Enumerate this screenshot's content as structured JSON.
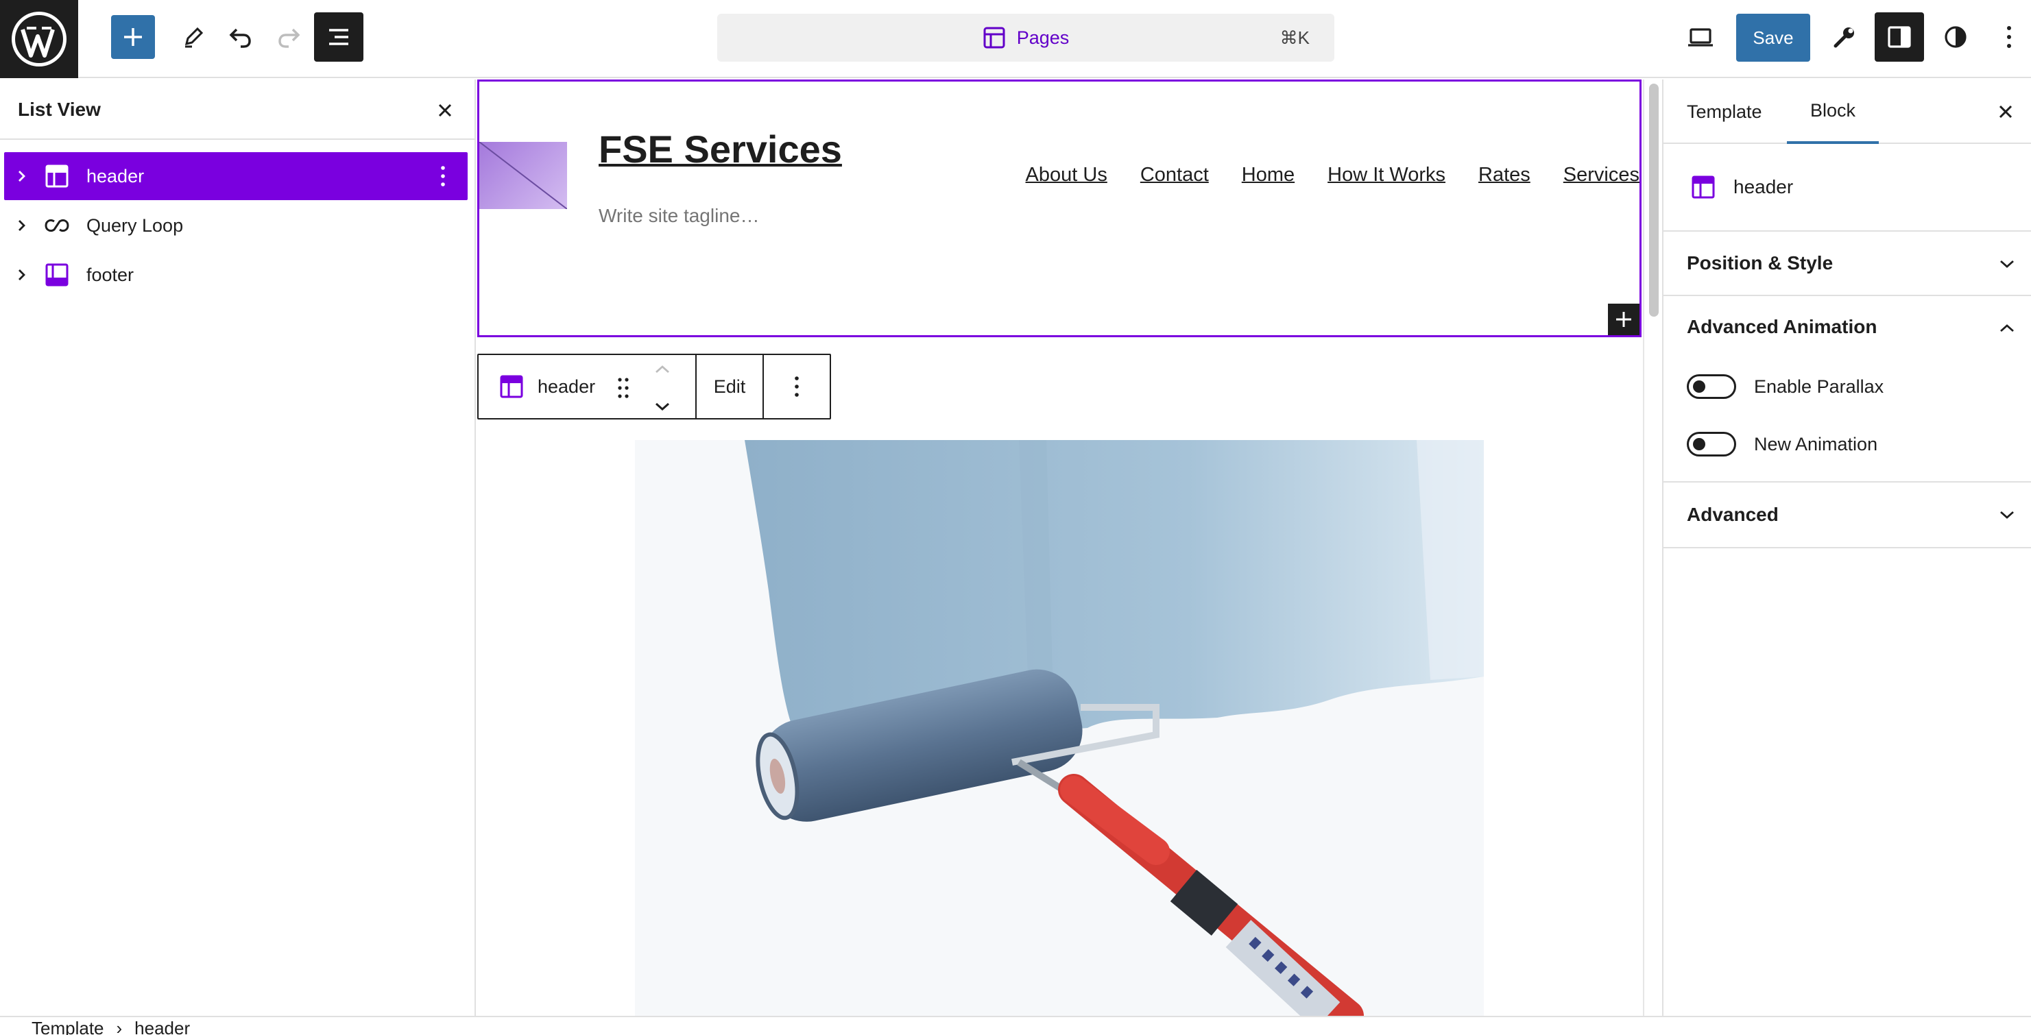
{
  "topbar": {
    "command": {
      "label": "Pages",
      "shortcut": "⌘K"
    },
    "save_label": "Save"
  },
  "list_view": {
    "title": "List View",
    "items": [
      {
        "label": "header",
        "icon": "template-part-header-icon",
        "selected": true
      },
      {
        "label": "Query Loop",
        "icon": "loop-icon",
        "selected": false
      },
      {
        "label": "footer",
        "icon": "template-part-footer-icon",
        "selected": false
      }
    ]
  },
  "canvas": {
    "site_title": "FSE Services",
    "tagline_placeholder": "Write site tagline…",
    "nav": [
      "About Us",
      "Contact",
      "Home",
      "How It Works",
      "Rates",
      "Services"
    ],
    "block_toolbar": {
      "block_label": "header",
      "edit_label": "Edit"
    }
  },
  "sidebar": {
    "tabs": [
      "Template",
      "Block"
    ],
    "active_tab": "Block",
    "block_name": "header",
    "sections": {
      "position_style": "Position & Style",
      "advanced_animation": "Advanced Animation",
      "advanced": "Advanced"
    },
    "toggles": [
      {
        "label": "Enable Parallax",
        "checked": false
      },
      {
        "label": "New Animation",
        "checked": false
      }
    ]
  },
  "breadcrumbs": [
    "Template",
    "header"
  ],
  "colors": {
    "accent": "#7a00df",
    "primary_button": "#3071a9",
    "dark": "#1e1e1e"
  }
}
